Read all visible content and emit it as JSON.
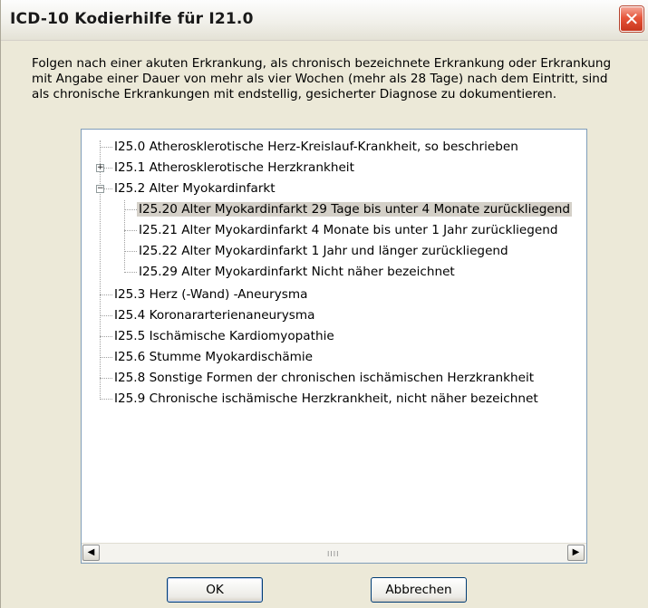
{
  "dialog": {
    "title": "ICD-10 Kodierhilfe für I21.0",
    "close_glyph": "✕",
    "description_lines": [
      "Folgen nach einer akuten Erkrankung, als chronisch bezeichnete Erkrankung oder Erkrankung",
      "mit Angabe einer Dauer von mehr als vier Wochen (mehr als 28 Tage) nach dem Eintritt, sind",
      "als chronische Erkrankungen mit endstellig, gesicherter Diagnose zu dokumentieren."
    ]
  },
  "tree": {
    "items": [
      {
        "label": "I25.0 Atherosklerotische Herz-Kreislauf-Krankheit, so beschrieben"
      },
      {
        "label": "I25.1 Atherosklerotische Herzkrankheit",
        "expander": "+"
      },
      {
        "label": "I25.2 Alter Myokardinfarkt",
        "expander": "−"
      },
      {
        "label": "I25.20 Alter Myokardinfarkt 29 Tage bis unter 4 Monate zurückliegend"
      },
      {
        "label": "I25.21 Alter Myokardinfarkt 4 Monate bis unter 1 Jahr zurückliegend"
      },
      {
        "label": "I25.22 Alter Myokardinfarkt 1 Jahr und länger zurückliegend"
      },
      {
        "label": "I25.29 Alter Myokardinfarkt Nicht näher bezeichnet"
      },
      {
        "label": "I25.3 Herz (-Wand) -Aneurysma"
      },
      {
        "label": "I25.4 Koronararterienaneurysma"
      },
      {
        "label": "I25.5 Ischämische Kardiomyopathie"
      },
      {
        "label": "I25.6 Stumme Myokardischämie"
      },
      {
        "label": "I25.8 Sonstige Formen der chronischen ischämischen Herzkrankheit"
      },
      {
        "label": "I25.9 Chronische ischämische Herzkrankheit, nicht näher bezeichnet"
      }
    ],
    "selected_label": "I25.20 Alter Myokardinfarkt 29 Tage bis unter 4 Monate zurückliegend"
  },
  "scrollbar": {
    "left_arrow": "◀",
    "right_arrow": "▶",
    "grip": "IIII"
  },
  "buttons": {
    "ok_label": "OK",
    "cancel_label": "Abbrechen"
  }
}
